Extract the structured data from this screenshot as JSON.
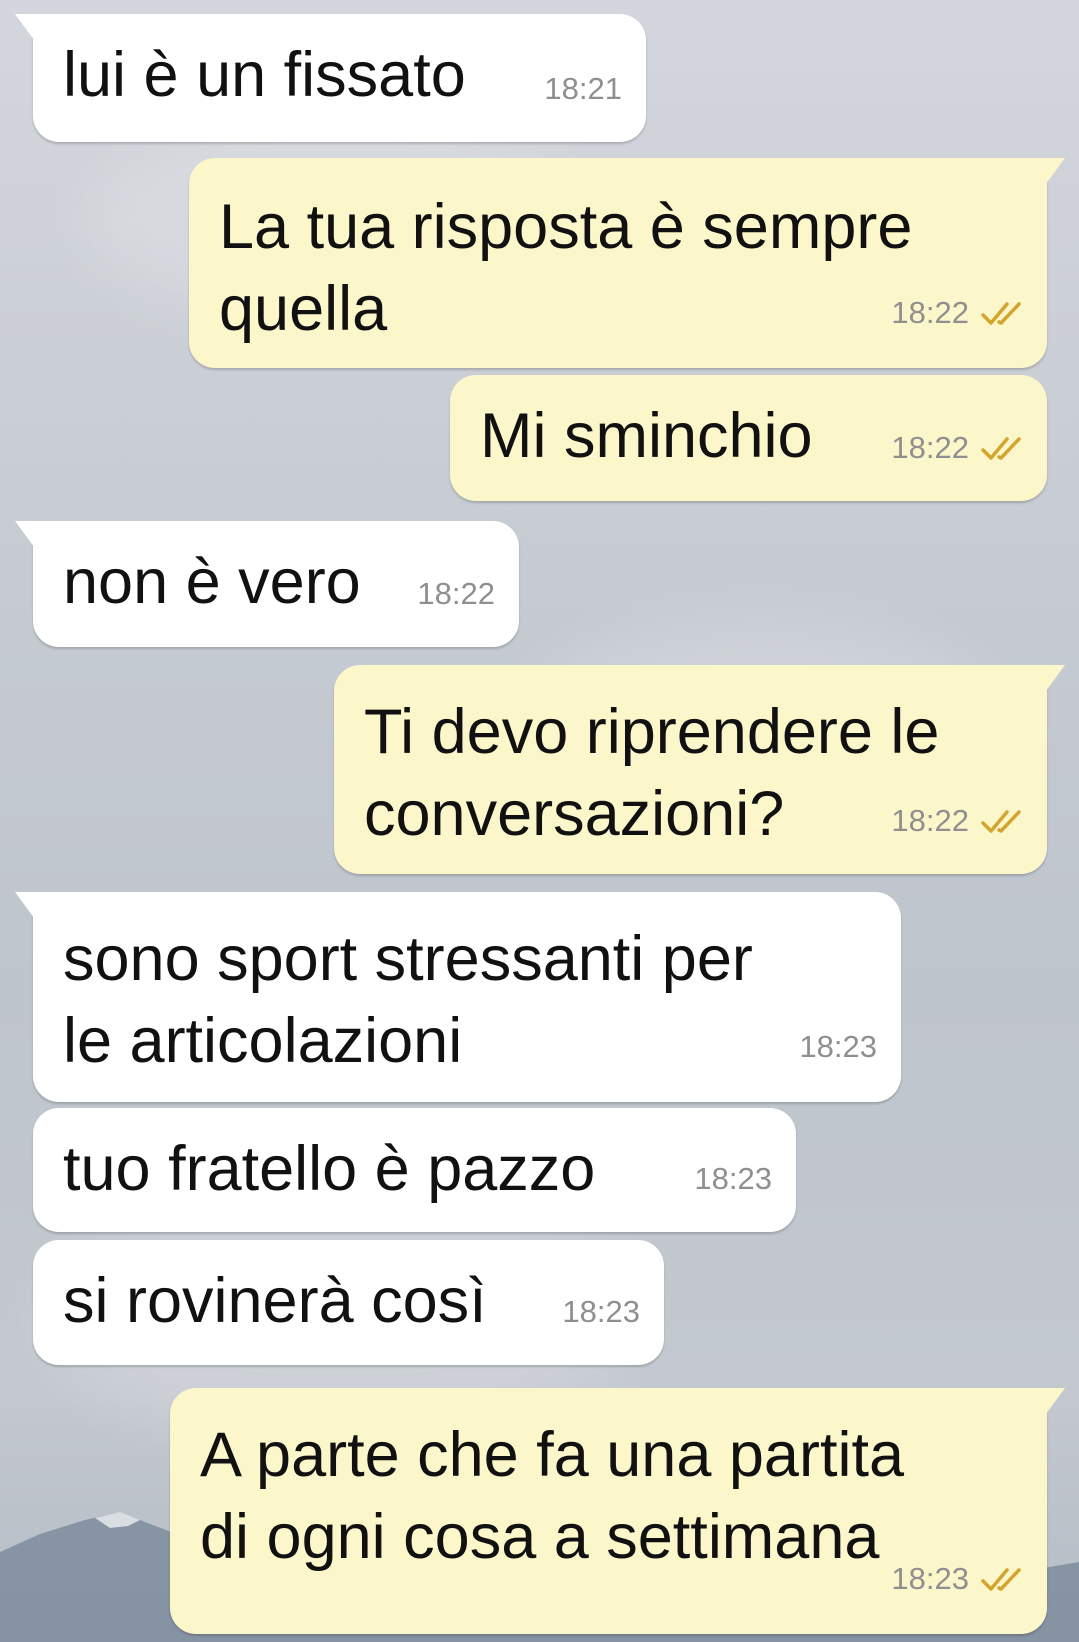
{
  "colors": {
    "incoming_bubble": "#ffffff",
    "outgoing_bubble": "#fcf6cb",
    "timestamp": "#8f8f8f",
    "read_ticks": "#d4a52e",
    "text": "#111111"
  },
  "messages": [
    {
      "direction": "incoming",
      "lines": [
        "lui è un fissato"
      ],
      "time": "18:21"
    },
    {
      "direction": "outgoing",
      "lines": [
        "La tua risposta è sempre",
        "quella"
      ],
      "time": "18:22",
      "status_icon": "double-check-icon"
    },
    {
      "direction": "outgoing",
      "lines": [
        "Mi sminchio"
      ],
      "time": "18:22",
      "status_icon": "double-check-icon"
    },
    {
      "direction": "incoming",
      "lines": [
        "non è vero"
      ],
      "time": "18:22"
    },
    {
      "direction": "outgoing",
      "lines": [
        "Ti devo riprendere le",
        "conversazioni?"
      ],
      "time": "18:22",
      "status_icon": "double-check-icon"
    },
    {
      "direction": "incoming",
      "lines": [
        "sono sport stressanti per",
        "le articolazioni"
      ],
      "time": "18:23"
    },
    {
      "direction": "incoming",
      "lines": [
        "tuo fratello è pazzo"
      ],
      "time": "18:23"
    },
    {
      "direction": "incoming",
      "lines": [
        "si rovinerà così"
      ],
      "time": "18:23"
    },
    {
      "direction": "outgoing",
      "lines": [
        "A parte che fa una partita",
        "di ogni cosa a settimana"
      ],
      "time": "18:23",
      "status_icon": "double-check-icon"
    }
  ]
}
